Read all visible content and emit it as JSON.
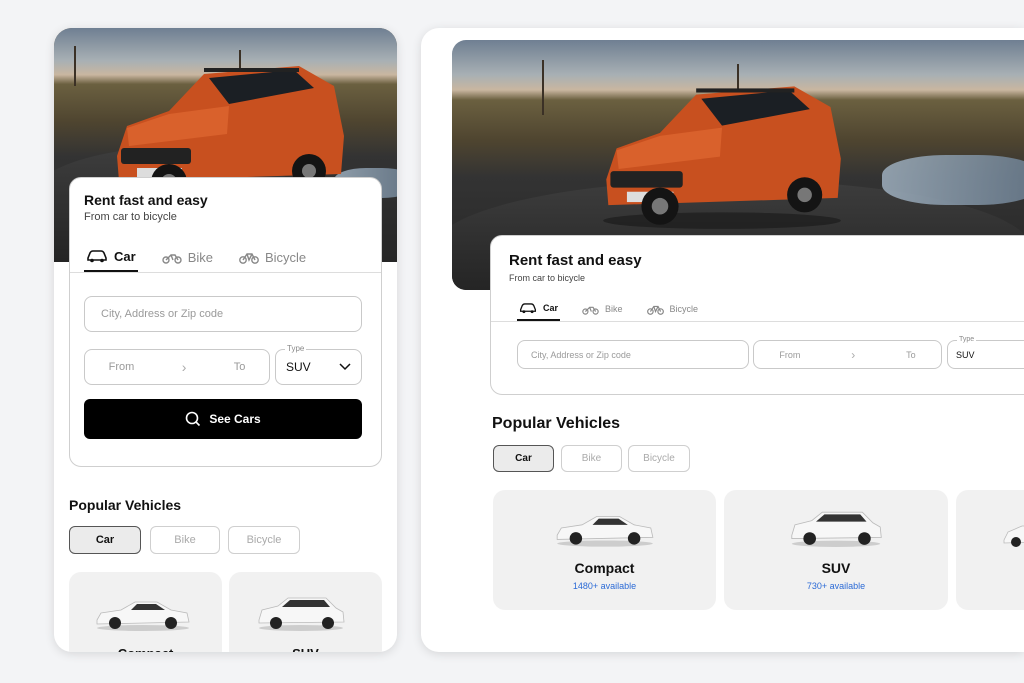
{
  "hero": {
    "title": "Rent fast and easy",
    "subtitle": "From car to bicycle"
  },
  "tabs": [
    {
      "label": "Car",
      "icon": "car-icon",
      "active": true
    },
    {
      "label": "Bike",
      "icon": "motorbike-icon",
      "active": false
    },
    {
      "label": "Bicycle",
      "icon": "bicycle-icon",
      "active": false
    }
  ],
  "search": {
    "location_placeholder": "City, Address or Zip code",
    "from_placeholder": "From",
    "to_placeholder": "To",
    "type_label": "Type",
    "type_value": "SUV",
    "submit_label": "See Cars"
  },
  "popular": {
    "title": "Popular Vehicles",
    "filters": [
      {
        "label": "Car",
        "active": true
      },
      {
        "label": "Bike",
        "active": false
      },
      {
        "label": "Bicycle",
        "active": false
      }
    ],
    "vehicles": [
      {
        "name": "Compact",
        "available": "1480+ available"
      },
      {
        "name": "SUV",
        "available": "730+ available"
      }
    ]
  },
  "colors": {
    "accent_blue": "#2c6bd6",
    "primary_button": "#000000",
    "car_orange": "#c8501f"
  }
}
